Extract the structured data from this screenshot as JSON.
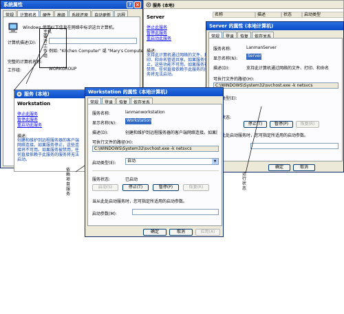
{
  "sysprops": {
    "title": "系统属性",
    "tabs": [
      "常规",
      "计算机名",
      "硬件",
      "高级",
      "系统还原",
      "自动更新",
      "远程"
    ],
    "desc": "Windows 使用以下信息在网络中标识这台计算机。",
    "desc_label": "计算机描述(D):",
    "example": "例如: \"Kitchen Computer\" 或 \"Mary's Computer\"。",
    "fullname_label": "完整的计算机名称:",
    "workgroup_label": "工作组:",
    "workgroup_value": "WORKGROUP",
    "annot": [
      "主机",
      "要",
      "对",
      "工",
      "作",
      "组"
    ]
  },
  "services_bg": {
    "title": "服务 (本地)",
    "service_name": "Server",
    "links": [
      "停止此服务",
      "暂停此服务",
      "重启动此服务"
    ],
    "desc_heading": "描述:",
    "desc_lines": [
      "支持此计算机通过网络的文件、打印、和命名管道共享。如果服务停止，这些功能不可用。如果服务被禁用，任何直接依赖于此服务的服务将无法启动。"
    ],
    "col_headers": [
      "名称",
      "描述",
      "状态",
      "启动类型"
    ]
  },
  "server_props": {
    "title": "Server 的属性 (本地计算机)",
    "tabs": [
      "常规",
      "登录",
      "恢复",
      "依存关系"
    ],
    "service_name_label": "服务名称:",
    "service_name_value": "LanmanServer",
    "display_name_label": "显示名称(N):",
    "display_name_value": "Server",
    "desc_label": "描述(D):",
    "desc_value": "支持此计算机通过网络的文件、打印、和命名",
    "path_label": "可执行文件的路径(H):",
    "path_value": "C:\\WINDOWS\\System32\\svchost.exe -k netsvcs",
    "startup_label": "启动类型(E):",
    "status_label": "服务状态:",
    "btn_stop": "停止(T)",
    "btn_pause": "暂停(P)",
    "btn_resume": "恢复(R)",
    "start_params_note": "当从此处启动服务时，您可指定所适用的启动参数。",
    "btn_ok": "确定",
    "btn_cancel": "取消",
    "annot": [
      "运",
      "行",
      "状",
      "态"
    ]
  },
  "services_front": {
    "title": "服务 (本地)",
    "service_name": "Workstation",
    "links": [
      "停止此服务",
      "暂停此服务",
      "重启动此服务"
    ],
    "desc_heading": "描述:",
    "desc_lines": [
      "创建和维护到远程服务器的客户端网络连接。如果服务停止，这些连接将不可用。如果服务被禁用，任何直接依赖于此服务的服务将无法启动。"
    ],
    "annot": [
      "依",
      "赖",
      "项",
      "目",
      "服",
      "务"
    ]
  },
  "ws_props": {
    "title": "Workstation 的属性 (本地计算机)",
    "tabs": [
      "常规",
      "登录",
      "恢复",
      "依存关系"
    ],
    "service_name_label": "服务名称:",
    "service_name_value": "lanmanworkstation",
    "display_name_label": "显示名称(N):",
    "display_name_value": "Workstation",
    "desc_label": "描述(D):",
    "desc_value": "创建和维护到远程服务器的客户端网络连接。如果服务",
    "path_label": "可执行文件的路径(H):",
    "path_value": "C:\\WINDOWS\\System32\\svchost.exe -k netsvcs",
    "startup_label": "启动类型(E):",
    "startup_value": "自动",
    "status_label": "服务状态:",
    "status_value": "已启动",
    "btn_start": "启动(S)",
    "btn_stop": "停止(T)",
    "btn_pause": "暂停(P)",
    "btn_resume": "恢复(R)",
    "start_params_note": "当从此处启动服务时，您可指定所适用的启动参数。",
    "start_params_label": "启动参数(M):",
    "btn_ok": "确定",
    "btn_cancel": "取消",
    "btn_apply": "应用(A)"
  }
}
